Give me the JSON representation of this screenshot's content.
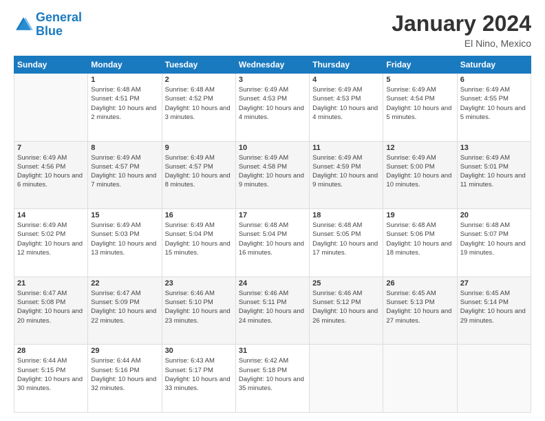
{
  "logo": {
    "line1": "General",
    "line2": "Blue"
  },
  "title": "January 2024",
  "location": "El Nino, Mexico",
  "days_header": [
    "Sunday",
    "Monday",
    "Tuesday",
    "Wednesday",
    "Thursday",
    "Friday",
    "Saturday"
  ],
  "weeks": [
    [
      {
        "day": "",
        "sunrise": "",
        "sunset": "",
        "daylight": ""
      },
      {
        "day": "1",
        "sunrise": "Sunrise: 6:48 AM",
        "sunset": "Sunset: 4:51 PM",
        "daylight": "Daylight: 10 hours and 2 minutes."
      },
      {
        "day": "2",
        "sunrise": "Sunrise: 6:48 AM",
        "sunset": "Sunset: 4:52 PM",
        "daylight": "Daylight: 10 hours and 3 minutes."
      },
      {
        "day": "3",
        "sunrise": "Sunrise: 6:49 AM",
        "sunset": "Sunset: 4:53 PM",
        "daylight": "Daylight: 10 hours and 4 minutes."
      },
      {
        "day": "4",
        "sunrise": "Sunrise: 6:49 AM",
        "sunset": "Sunset: 4:53 PM",
        "daylight": "Daylight: 10 hours and 4 minutes."
      },
      {
        "day": "5",
        "sunrise": "Sunrise: 6:49 AM",
        "sunset": "Sunset: 4:54 PM",
        "daylight": "Daylight: 10 hours and 5 minutes."
      },
      {
        "day": "6",
        "sunrise": "Sunrise: 6:49 AM",
        "sunset": "Sunset: 4:55 PM",
        "daylight": "Daylight: 10 hours and 5 minutes."
      }
    ],
    [
      {
        "day": "7",
        "sunrise": "Sunrise: 6:49 AM",
        "sunset": "Sunset: 4:56 PM",
        "daylight": "Daylight: 10 hours and 6 minutes."
      },
      {
        "day": "8",
        "sunrise": "Sunrise: 6:49 AM",
        "sunset": "Sunset: 4:57 PM",
        "daylight": "Daylight: 10 hours and 7 minutes."
      },
      {
        "day": "9",
        "sunrise": "Sunrise: 6:49 AM",
        "sunset": "Sunset: 4:57 PM",
        "daylight": "Daylight: 10 hours and 8 minutes."
      },
      {
        "day": "10",
        "sunrise": "Sunrise: 6:49 AM",
        "sunset": "Sunset: 4:58 PM",
        "daylight": "Daylight: 10 hours and 9 minutes."
      },
      {
        "day": "11",
        "sunrise": "Sunrise: 6:49 AM",
        "sunset": "Sunset: 4:59 PM",
        "daylight": "Daylight: 10 hours and 9 minutes."
      },
      {
        "day": "12",
        "sunrise": "Sunrise: 6:49 AM",
        "sunset": "Sunset: 5:00 PM",
        "daylight": "Daylight: 10 hours and 10 minutes."
      },
      {
        "day": "13",
        "sunrise": "Sunrise: 6:49 AM",
        "sunset": "Sunset: 5:01 PM",
        "daylight": "Daylight: 10 hours and 11 minutes."
      }
    ],
    [
      {
        "day": "14",
        "sunrise": "Sunrise: 6:49 AM",
        "sunset": "Sunset: 5:02 PM",
        "daylight": "Daylight: 10 hours and 12 minutes."
      },
      {
        "day": "15",
        "sunrise": "Sunrise: 6:49 AM",
        "sunset": "Sunset: 5:03 PM",
        "daylight": "Daylight: 10 hours and 13 minutes."
      },
      {
        "day": "16",
        "sunrise": "Sunrise: 6:49 AM",
        "sunset": "Sunset: 5:04 PM",
        "daylight": "Daylight: 10 hours and 15 minutes."
      },
      {
        "day": "17",
        "sunrise": "Sunrise: 6:48 AM",
        "sunset": "Sunset: 5:04 PM",
        "daylight": "Daylight: 10 hours and 16 minutes."
      },
      {
        "day": "18",
        "sunrise": "Sunrise: 6:48 AM",
        "sunset": "Sunset: 5:05 PM",
        "daylight": "Daylight: 10 hours and 17 minutes."
      },
      {
        "day": "19",
        "sunrise": "Sunrise: 6:48 AM",
        "sunset": "Sunset: 5:06 PM",
        "daylight": "Daylight: 10 hours and 18 minutes."
      },
      {
        "day": "20",
        "sunrise": "Sunrise: 6:48 AM",
        "sunset": "Sunset: 5:07 PM",
        "daylight": "Daylight: 10 hours and 19 minutes."
      }
    ],
    [
      {
        "day": "21",
        "sunrise": "Sunrise: 6:47 AM",
        "sunset": "Sunset: 5:08 PM",
        "daylight": "Daylight: 10 hours and 20 minutes."
      },
      {
        "day": "22",
        "sunrise": "Sunrise: 6:47 AM",
        "sunset": "Sunset: 5:09 PM",
        "daylight": "Daylight: 10 hours and 22 minutes."
      },
      {
        "day": "23",
        "sunrise": "Sunrise: 6:46 AM",
        "sunset": "Sunset: 5:10 PM",
        "daylight": "Daylight: 10 hours and 23 minutes."
      },
      {
        "day": "24",
        "sunrise": "Sunrise: 6:46 AM",
        "sunset": "Sunset: 5:11 PM",
        "daylight": "Daylight: 10 hours and 24 minutes."
      },
      {
        "day": "25",
        "sunrise": "Sunrise: 6:46 AM",
        "sunset": "Sunset: 5:12 PM",
        "daylight": "Daylight: 10 hours and 26 minutes."
      },
      {
        "day": "26",
        "sunrise": "Sunrise: 6:45 AM",
        "sunset": "Sunset: 5:13 PM",
        "daylight": "Daylight: 10 hours and 27 minutes."
      },
      {
        "day": "27",
        "sunrise": "Sunrise: 6:45 AM",
        "sunset": "Sunset: 5:14 PM",
        "daylight": "Daylight: 10 hours and 29 minutes."
      }
    ],
    [
      {
        "day": "28",
        "sunrise": "Sunrise: 6:44 AM",
        "sunset": "Sunset: 5:15 PM",
        "daylight": "Daylight: 10 hours and 30 minutes."
      },
      {
        "day": "29",
        "sunrise": "Sunrise: 6:44 AM",
        "sunset": "Sunset: 5:16 PM",
        "daylight": "Daylight: 10 hours and 32 minutes."
      },
      {
        "day": "30",
        "sunrise": "Sunrise: 6:43 AM",
        "sunset": "Sunset: 5:17 PM",
        "daylight": "Daylight: 10 hours and 33 minutes."
      },
      {
        "day": "31",
        "sunrise": "Sunrise: 6:42 AM",
        "sunset": "Sunset: 5:18 PM",
        "daylight": "Daylight: 10 hours and 35 minutes."
      },
      {
        "day": "",
        "sunrise": "",
        "sunset": "",
        "daylight": ""
      },
      {
        "day": "",
        "sunrise": "",
        "sunset": "",
        "daylight": ""
      },
      {
        "day": "",
        "sunrise": "",
        "sunset": "",
        "daylight": ""
      }
    ]
  ]
}
